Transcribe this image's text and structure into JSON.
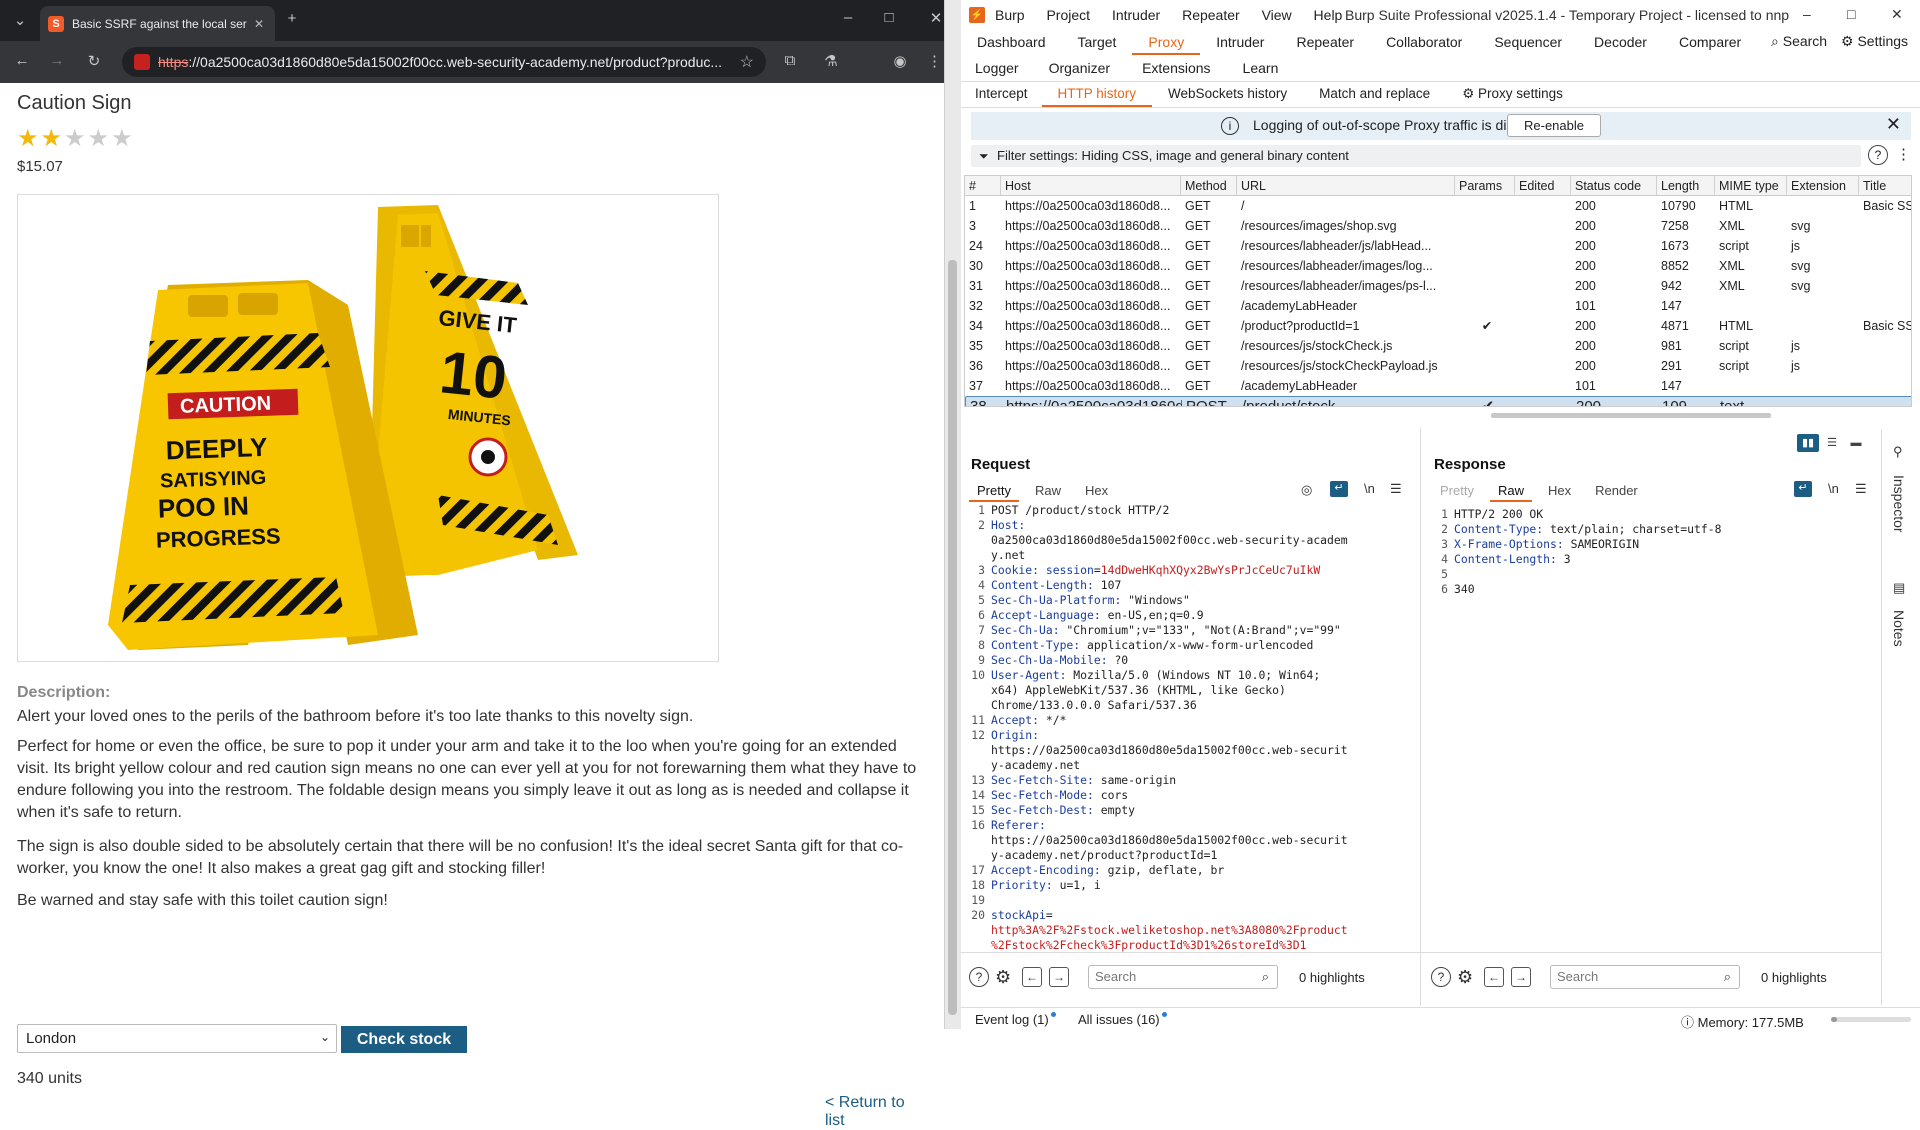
{
  "browser": {
    "tab_title": "Basic SSRF against the local ser",
    "url_scheme": "https",
    "url_rest": "://0a2500ca03d1860d80e5da15002f00cc.web-security-academy.net/product?produc...",
    "favicon_letter": "S"
  },
  "product": {
    "title": "Caution Sign",
    "rating": 2,
    "rating_max": 5,
    "price": "$15.07",
    "image_alt": "Caution sign product image",
    "sign_texts": {
      "caution": "CAUTION",
      "front": "DEEPLY SATISYING POO IN PROGRESS",
      "back_top": "GIVE IT",
      "back_num": "10",
      "back_bottom": "MINUTES"
    },
    "description_label": "Description:",
    "paragraphs": [
      "Alert your loved ones to the perils of the bathroom before it's too late thanks to this novelty sign.",
      "Perfect for home or even the office, be sure to pop it under your arm and take it to the loo when you're going for an extended visit. Its bright yellow colour and red caution sign means no one can ever yell at you for not forewarning them what they have to endure following you into the restroom. The foldable design means you simply leave it out as long as is needed and collapse it when it's safe to return.",
      "The sign is also double sided to be absolutely certain that there will be no confusion! It's the ideal secret Santa gift for that co-worker, you know the one! It also makes a great gag gift and stocking filler!",
      "Be warned and stay safe with this toilet caution sign!"
    ],
    "store_selected": "London",
    "check_stock_label": "Check stock",
    "stock_result": "340 units",
    "return_link": "< Return to list"
  },
  "burp": {
    "menu": [
      "Burp",
      "Project",
      "Intruder",
      "Repeater",
      "View",
      "Help"
    ],
    "app_title": "Burp Suite Professional v2025.1.4 - Temporary Project - licensed to nnp",
    "main_tabs_row1": [
      "Dashboard",
      "Target",
      "Proxy",
      "Intruder",
      "Repeater",
      "Collaborator",
      "Sequencer",
      "Decoder",
      "Comparer"
    ],
    "main_tabs_row2": [
      "Logger",
      "Organizer",
      "Extensions",
      "Learn"
    ],
    "search_label": "Search",
    "settings_label": "Settings",
    "proxy_tabs": [
      "Intercept",
      "HTTP history",
      "WebSockets history",
      "Match and replace"
    ],
    "proxy_settings_label": "Proxy settings",
    "notice_text": "Logging of out-of-scope Proxy traffic is disabled",
    "reenable_label": "Re-enable",
    "filter_text": "Filter settings: Hiding CSS, image and general binary content",
    "columns": [
      "#",
      "Host",
      "Method",
      "URL",
      "Params",
      "Edited",
      "Status code",
      "Length",
      "MIME type",
      "Extension",
      "Title"
    ],
    "rows": [
      {
        "n": "1",
        "host": "https://0a2500ca03d1860d8...",
        "method": "GET",
        "url": "/",
        "params": "",
        "status": "200",
        "length": "10790",
        "mime": "HTML",
        "ext": "",
        "title": "Basic SSR"
      },
      {
        "n": "3",
        "host": "https://0a2500ca03d1860d8...",
        "method": "GET",
        "url": "/resources/images/shop.svg",
        "params": "",
        "status": "200",
        "length": "7258",
        "mime": "XML",
        "ext": "svg",
        "title": ""
      },
      {
        "n": "24",
        "host": "https://0a2500ca03d1860d8...",
        "method": "GET",
        "url": "/resources/labheader/js/labHead...",
        "params": "",
        "status": "200",
        "length": "1673",
        "mime": "script",
        "ext": "js",
        "title": ""
      },
      {
        "n": "30",
        "host": "https://0a2500ca03d1860d8...",
        "method": "GET",
        "url": "/resources/labheader/images/log...",
        "params": "",
        "status": "200",
        "length": "8852",
        "mime": "XML",
        "ext": "svg",
        "title": ""
      },
      {
        "n": "31",
        "host": "https://0a2500ca03d1860d8...",
        "method": "GET",
        "url": "/resources/labheader/images/ps-l...",
        "params": "",
        "status": "200",
        "length": "942",
        "mime": "XML",
        "ext": "svg",
        "title": ""
      },
      {
        "n": "32",
        "host": "https://0a2500ca03d1860d8...",
        "method": "GET",
        "url": "/academyLabHeader",
        "params": "",
        "status": "101",
        "length": "147",
        "mime": "",
        "ext": "",
        "title": ""
      },
      {
        "n": "34",
        "host": "https://0a2500ca03d1860d8...",
        "method": "GET",
        "url": "/product?productId=1",
        "params": "✔",
        "status": "200",
        "length": "4871",
        "mime": "HTML",
        "ext": "",
        "title": "Basic SSR"
      },
      {
        "n": "35",
        "host": "https://0a2500ca03d1860d8...",
        "method": "GET",
        "url": "/resources/js/stockCheck.js",
        "params": "",
        "status": "200",
        "length": "981",
        "mime": "script",
        "ext": "js",
        "title": ""
      },
      {
        "n": "36",
        "host": "https://0a2500ca03d1860d8...",
        "method": "GET",
        "url": "/resources/js/stockCheckPayload.js",
        "params": "",
        "status": "200",
        "length": "291",
        "mime": "script",
        "ext": "js",
        "title": ""
      },
      {
        "n": "37",
        "host": "https://0a2500ca03d1860d8...",
        "method": "GET",
        "url": "/academyLabHeader",
        "params": "",
        "status": "101",
        "length": "147",
        "mime": "",
        "ext": "",
        "title": ""
      },
      {
        "n": "38",
        "host": "https://0a2500ca03d1860d8...",
        "method": "POST",
        "url": "/product/stock",
        "params": "✔",
        "status": "200",
        "length": "109",
        "mime": "text",
        "ext": "",
        "title": ""
      }
    ],
    "selected_row": "38",
    "request_title": "Request",
    "response_title": "Response",
    "request_tabs": [
      "Pretty",
      "Raw",
      "Hex"
    ],
    "response_tabs": [
      "Pretty",
      "Raw",
      "Hex",
      "Render"
    ],
    "newline_toggle": "\\n",
    "request_lines": [
      {
        "n": "1",
        "parts": [
          [
            "v",
            "POST /product/stock HTTP/2"
          ]
        ]
      },
      {
        "n": "2",
        "parts": [
          [
            "k",
            "Host:"
          ]
        ]
      },
      {
        "n": "",
        "parts": [
          [
            "v",
            "0a2500ca03d1860d80e5da15002f00cc.web-security-academ"
          ]
        ]
      },
      {
        "n": "",
        "parts": [
          [
            "v",
            "y.net"
          ]
        ]
      },
      {
        "n": "3",
        "parts": [
          [
            "k",
            "Cookie: session"
          ],
          [
            "v",
            "="
          ],
          [
            "r",
            "14dDweHKqhXQyx2BwYsPrJcCeUc7uIkW"
          ]
        ]
      },
      {
        "n": "4",
        "parts": [
          [
            "k",
            "Content-Length:"
          ],
          [
            "v",
            " 107"
          ]
        ]
      },
      {
        "n": "5",
        "parts": [
          [
            "k",
            "Sec-Ch-Ua-Platform:"
          ],
          [
            "v",
            " \"Windows\""
          ]
        ]
      },
      {
        "n": "6",
        "parts": [
          [
            "k",
            "Accept-Language:"
          ],
          [
            "v",
            " en-US,en;q=0.9"
          ]
        ]
      },
      {
        "n": "7",
        "parts": [
          [
            "k",
            "Sec-Ch-Ua:"
          ],
          [
            "v",
            " \"Chromium\";v=\"133\", \"Not(A:Brand\";v=\"99\""
          ]
        ]
      },
      {
        "n": "8",
        "parts": [
          [
            "k",
            "Content-Type:"
          ],
          [
            "v",
            " application/x-www-form-urlencoded"
          ]
        ]
      },
      {
        "n": "9",
        "parts": [
          [
            "k",
            "Sec-Ch-Ua-Mobile:"
          ],
          [
            "v",
            " ?0"
          ]
        ]
      },
      {
        "n": "10",
        "parts": [
          [
            "k",
            "User-Agent:"
          ],
          [
            "v",
            " Mozilla/5.0 (Windows NT 10.0; Win64;"
          ]
        ]
      },
      {
        "n": "",
        "parts": [
          [
            "v",
            "x64) AppleWebKit/537.36 (KHTML, like Gecko)"
          ]
        ]
      },
      {
        "n": "",
        "parts": [
          [
            "v",
            "Chrome/133.0.0.0 Safari/537.36"
          ]
        ]
      },
      {
        "n": "11",
        "parts": [
          [
            "k",
            "Accept:"
          ],
          [
            "v",
            " */*"
          ]
        ]
      },
      {
        "n": "12",
        "parts": [
          [
            "k",
            "Origin:"
          ]
        ]
      },
      {
        "n": "",
        "parts": [
          [
            "v",
            "https://0a2500ca03d1860d80e5da15002f00cc.web-securit"
          ]
        ]
      },
      {
        "n": "",
        "parts": [
          [
            "v",
            "y-academy.net"
          ]
        ]
      },
      {
        "n": "13",
        "parts": [
          [
            "k",
            "Sec-Fetch-Site:"
          ],
          [
            "v",
            " same-origin"
          ]
        ]
      },
      {
        "n": "14",
        "parts": [
          [
            "k",
            "Sec-Fetch-Mode:"
          ],
          [
            "v",
            " cors"
          ]
        ]
      },
      {
        "n": "15",
        "parts": [
          [
            "k",
            "Sec-Fetch-Dest:"
          ],
          [
            "v",
            " empty"
          ]
        ]
      },
      {
        "n": "16",
        "parts": [
          [
            "k",
            "Referer:"
          ]
        ]
      },
      {
        "n": "",
        "parts": [
          [
            "v",
            "https://0a2500ca03d1860d80e5da15002f00cc.web-securit"
          ]
        ]
      },
      {
        "n": "",
        "parts": [
          [
            "v",
            "y-academy.net/product?productId=1"
          ]
        ]
      },
      {
        "n": "17",
        "parts": [
          [
            "k",
            "Accept-Encoding:"
          ],
          [
            "v",
            " gzip, deflate, br"
          ]
        ]
      },
      {
        "n": "18",
        "parts": [
          [
            "k",
            "Priority:"
          ],
          [
            "v",
            " u=1, i"
          ]
        ]
      },
      {
        "n": "19",
        "parts": []
      },
      {
        "n": "20",
        "parts": [
          [
            "k",
            "stockApi"
          ],
          [
            "v",
            "="
          ]
        ]
      },
      {
        "n": "",
        "parts": [
          [
            "r",
            "http%3A%2F%2Fstock.weliketoshop.net%3A8080%2Fproduct"
          ]
        ]
      },
      {
        "n": "",
        "parts": [
          [
            "r",
            "%2Fstock%2Fcheck%3FproductId%3D1%26storeId%3D1"
          ]
        ]
      }
    ],
    "response_lines": [
      {
        "n": "1",
        "parts": [
          [
            "v",
            "HTTP/2 200 OK"
          ]
        ]
      },
      {
        "n": "2",
        "parts": [
          [
            "k",
            "Content-Type:"
          ],
          [
            "v",
            " text/plain; charset=utf-8"
          ]
        ]
      },
      {
        "n": "3",
        "parts": [
          [
            "k",
            "X-Frame-Options:"
          ],
          [
            "v",
            " SAMEORIGIN"
          ]
        ]
      },
      {
        "n": "4",
        "parts": [
          [
            "k",
            "Content-Length:"
          ],
          [
            "v",
            " 3"
          ]
        ]
      },
      {
        "n": "5",
        "parts": []
      },
      {
        "n": "6",
        "parts": [
          [
            "v",
            "340"
          ]
        ]
      }
    ],
    "search_placeholder": "Search",
    "req_highlights": "0 highlights",
    "resp_highlights": "0 highlights",
    "inspector_label": "Inspector",
    "notes_label": "Notes",
    "event_log": "Event log (1)",
    "all_issues": "All issues (16)",
    "memory": "Memory: 177.5MB",
    "accent": "#e8661b"
  }
}
